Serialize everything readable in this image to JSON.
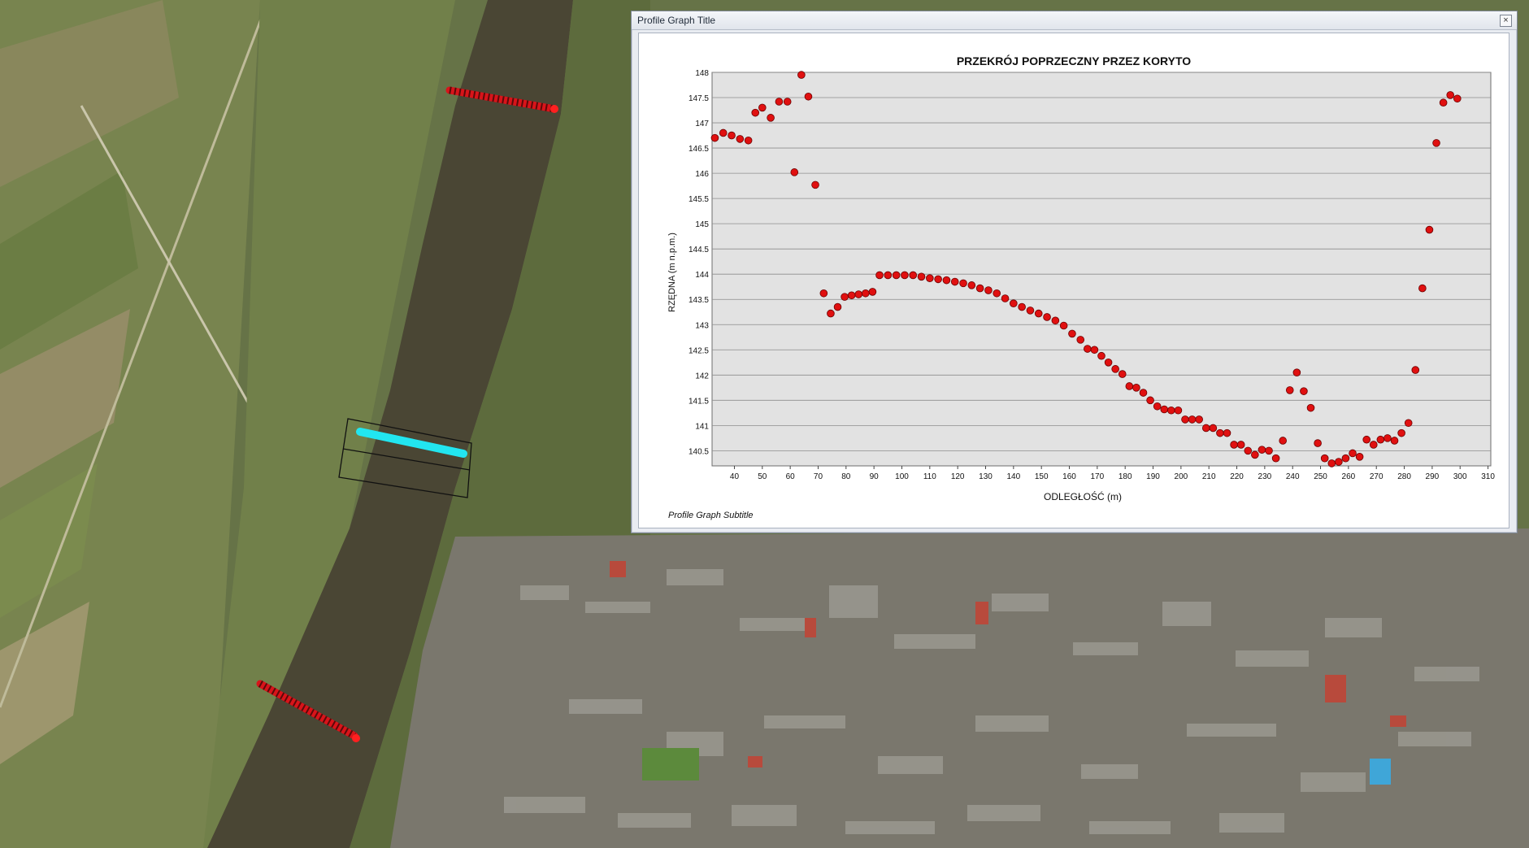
{
  "window": {
    "title": "Profile Graph Title",
    "close_label": "×"
  },
  "map": {
    "river_color": "#4a4634",
    "urban_color": "#7d7a72",
    "field_color": "#6f7a45",
    "cross_section_color": "#d8141a",
    "highlight_color": "#22e6f0"
  },
  "chart_data": {
    "type": "scatter",
    "title": "PRZEKRÓJ POPRZECZNY PRZEZ KORYTO",
    "subtitle": "Profile Graph Subtitle",
    "xlabel": "ODLEGŁOŚĆ (m)",
    "ylabel": "RZĘDNA (m n.p.m.)",
    "xlim": [
      32,
      311
    ],
    "ylim": [
      140.2,
      148
    ],
    "x_ticks": [
      "40",
      "50",
      "60",
      "70",
      "80",
      "90",
      "100",
      "110",
      "120",
      "130",
      "140",
      "150",
      "160",
      "170",
      "180",
      "190",
      "200",
      "210",
      "220",
      "230",
      "240",
      "250",
      "260",
      "270",
      "280",
      "290",
      "300",
      "310"
    ],
    "y_ticks": [
      "140.5",
      "141",
      "141.5",
      "142",
      "142.5",
      "143",
      "143.5",
      "144",
      "144.5",
      "145",
      "145.5",
      "146",
      "146.5",
      "147",
      "147.5",
      "148"
    ],
    "grid": true,
    "marker_color": "#e01010",
    "plot_background": "#e2e2e2",
    "series": [
      {
        "values": [
          [
            33,
            146.7
          ],
          [
            36,
            146.8
          ],
          [
            39,
            146.75
          ],
          [
            42,
            146.68
          ],
          [
            45,
            146.65
          ],
          [
            47.5,
            147.2
          ],
          [
            50,
            147.3
          ],
          [
            53,
            147.1
          ],
          [
            56,
            147.42
          ],
          [
            59,
            147.42
          ],
          [
            61.5,
            146.02
          ],
          [
            64,
            147.95
          ],
          [
            66.5,
            147.52
          ],
          [
            69,
            145.77
          ],
          [
            72,
            143.62
          ],
          [
            74.5,
            143.22
          ],
          [
            77,
            143.35
          ],
          [
            79.5,
            143.55
          ],
          [
            82,
            143.58
          ],
          [
            84.5,
            143.6
          ],
          [
            87,
            143.62
          ],
          [
            89.5,
            143.65
          ],
          [
            92,
            143.98
          ],
          [
            95,
            143.98
          ],
          [
            98,
            143.98
          ],
          [
            101,
            143.98
          ],
          [
            104,
            143.98
          ],
          [
            107,
            143.95
          ],
          [
            110,
            143.92
          ],
          [
            113,
            143.9
          ],
          [
            116,
            143.88
          ],
          [
            119,
            143.85
          ],
          [
            122,
            143.82
          ],
          [
            125,
            143.78
          ],
          [
            128,
            143.72
          ],
          [
            131,
            143.68
          ],
          [
            134,
            143.62
          ],
          [
            137,
            143.52
          ],
          [
            140,
            143.42
          ],
          [
            143,
            143.35
          ],
          [
            146,
            143.28
          ],
          [
            149,
            143.22
          ],
          [
            152,
            143.15
          ],
          [
            155,
            143.08
          ],
          [
            158,
            142.98
          ],
          [
            161,
            142.82
          ],
          [
            164,
            142.7
          ],
          [
            166.5,
            142.52
          ],
          [
            169,
            142.5
          ],
          [
            171.5,
            142.38
          ],
          [
            174,
            142.25
          ],
          [
            176.5,
            142.12
          ],
          [
            179,
            142.02
          ],
          [
            181.5,
            141.78
          ],
          [
            184,
            141.75
          ],
          [
            186.5,
            141.65
          ],
          [
            189,
            141.5
          ],
          [
            191.5,
            141.38
          ],
          [
            194,
            141.32
          ],
          [
            196.5,
            141.3
          ],
          [
            199,
            141.3
          ],
          [
            201.5,
            141.12
          ],
          [
            204,
            141.12
          ],
          [
            206.5,
            141.12
          ],
          [
            209,
            140.95
          ],
          [
            211.5,
            140.95
          ],
          [
            214,
            140.85
          ],
          [
            216.5,
            140.85
          ],
          [
            219,
            140.62
          ],
          [
            221.5,
            140.62
          ],
          [
            224,
            140.5
          ],
          [
            226.5,
            140.42
          ],
          [
            229,
            140.52
          ],
          [
            231.5,
            140.5
          ],
          [
            234,
            140.35
          ],
          [
            236.5,
            140.7
          ],
          [
            239,
            141.7
          ],
          [
            241.5,
            142.05
          ],
          [
            244,
            141.68
          ],
          [
            246.5,
            141.35
          ],
          [
            249,
            140.65
          ],
          [
            251.5,
            140.35
          ],
          [
            254,
            140.25
          ],
          [
            256.5,
            140.28
          ],
          [
            259,
            140.35
          ],
          [
            261.5,
            140.45
          ],
          [
            264,
            140.38
          ],
          [
            266.5,
            140.72
          ],
          [
            269,
            140.62
          ],
          [
            271.5,
            140.72
          ],
          [
            274,
            140.75
          ],
          [
            276.5,
            140.7
          ],
          [
            279,
            140.85
          ],
          [
            281.5,
            141.05
          ],
          [
            284,
            142.1
          ],
          [
            286.5,
            143.72
          ],
          [
            289,
            144.88
          ],
          [
            291.5,
            146.6
          ],
          [
            294,
            147.4
          ],
          [
            296.5,
            147.55
          ],
          [
            299,
            147.48
          ]
        ]
      }
    ]
  }
}
